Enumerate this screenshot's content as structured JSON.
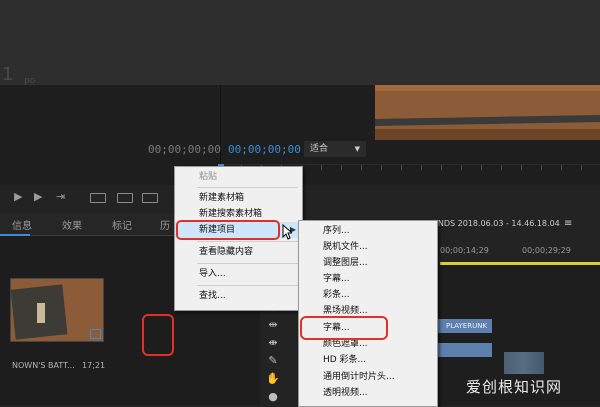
{
  "background": {
    "watermark_text": "po"
  },
  "source_monitor": {
    "timecode": "00;00;00;00"
  },
  "program_monitor": {
    "timecode": "00;00;00;00",
    "fit_label": "适合"
  },
  "panel_tabs": [
    "信息",
    "效果",
    "标记",
    "历"
  ],
  "project_item": {
    "name": "NOWN'S BATT...",
    "duration": "17;21"
  },
  "timeline": {
    "sequence_title": "UNDS 2018.06.03 - 14.46.18.04",
    "menu_icon": "≡",
    "ruler_label_1": "00;00;14;29",
    "ruler_label_2": "00;00;29;29",
    "clip_label": "PLAYERUNK"
  },
  "context_menu": {
    "items": [
      {
        "label": "粘贴",
        "disabled": true
      },
      {
        "label": "新建素材箱"
      },
      {
        "label": "新建搜索素材箱"
      },
      {
        "label": "新建项目",
        "highlighted": true,
        "submenu_arrow": "▶"
      },
      {
        "label": "查看隐藏内容"
      },
      {
        "label": "导入..."
      },
      {
        "label": "查找..."
      }
    ]
  },
  "submenu": {
    "items": [
      "序列...",
      "脱机文件...",
      "调整图层...",
      "字幕...",
      "彩条...",
      "黑场视频...",
      "字幕...",
      "颜色遮罩...",
      "HD 彩条...",
      "通用倒计时片头...",
      "透明视频..."
    ]
  },
  "site_watermark": {
    "text": "爱创根知识网"
  },
  "icons": [
    "play-icon",
    "step-forward-icon",
    "insert-icon",
    "overwrite-icon",
    "export-frame-icon",
    "selection-tool-icon",
    "razor-tool-icon",
    "slip-tool-icon",
    "pen-tool-icon",
    "hand-tool-icon",
    "mouse-cursor-icon"
  ],
  "colors": {
    "accent_blue": "#3a8ed6",
    "highlight_red": "#e0302a",
    "menu_bg": "#f0f0f0",
    "menu_highlight": "#cfe6fa"
  }
}
